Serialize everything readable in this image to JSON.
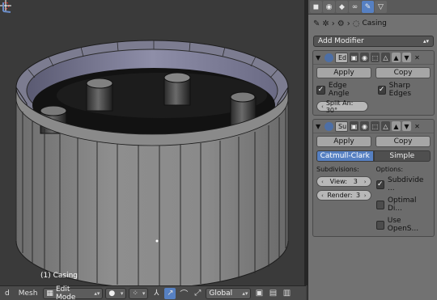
{
  "viewport": {
    "object_label": "(1) Casing"
  },
  "header": {
    "menu_d": "d",
    "menu_mesh": "Mesh",
    "mode": "Edit Mode",
    "orientation": "Global"
  },
  "properties": {
    "breadcrumb_object": "Casing",
    "add_modifier": "Add Modifier",
    "modifiers": [
      {
        "name": "Ed",
        "apply": "Apply",
        "copy": "Copy",
        "opt1": "Edge Angle",
        "opt2": "Sharp Edges",
        "split_angle": "Split An: 30°"
      },
      {
        "name": "Su",
        "apply": "Apply",
        "copy": "Copy",
        "type_sel": "Catmull-Clark",
        "type_unsel": "Simple",
        "subdivisions_label": "Subdivisions:",
        "view_label": "View:",
        "view_value": "3",
        "render_label": "Render:",
        "render_value": "3",
        "options_label": "Options:",
        "opt_subdivide": "Subdivide ...",
        "opt_optimal": "Optimal Di...",
        "opt_opensub": "Use OpenS..."
      }
    ]
  },
  "colors": {
    "accent": "#5680c2",
    "panel_bg": "#727272",
    "viewport_bg": "#3a3a3a"
  },
  "icons": [
    "pin-icon",
    "mesh-icon",
    "object-icon",
    "wrench-icon",
    "camera-icon",
    "eye-icon",
    "cursor-icon",
    "sphere-icon",
    "chevron-up-icon",
    "chevron-down-icon",
    "close-icon",
    "check-icon"
  ]
}
